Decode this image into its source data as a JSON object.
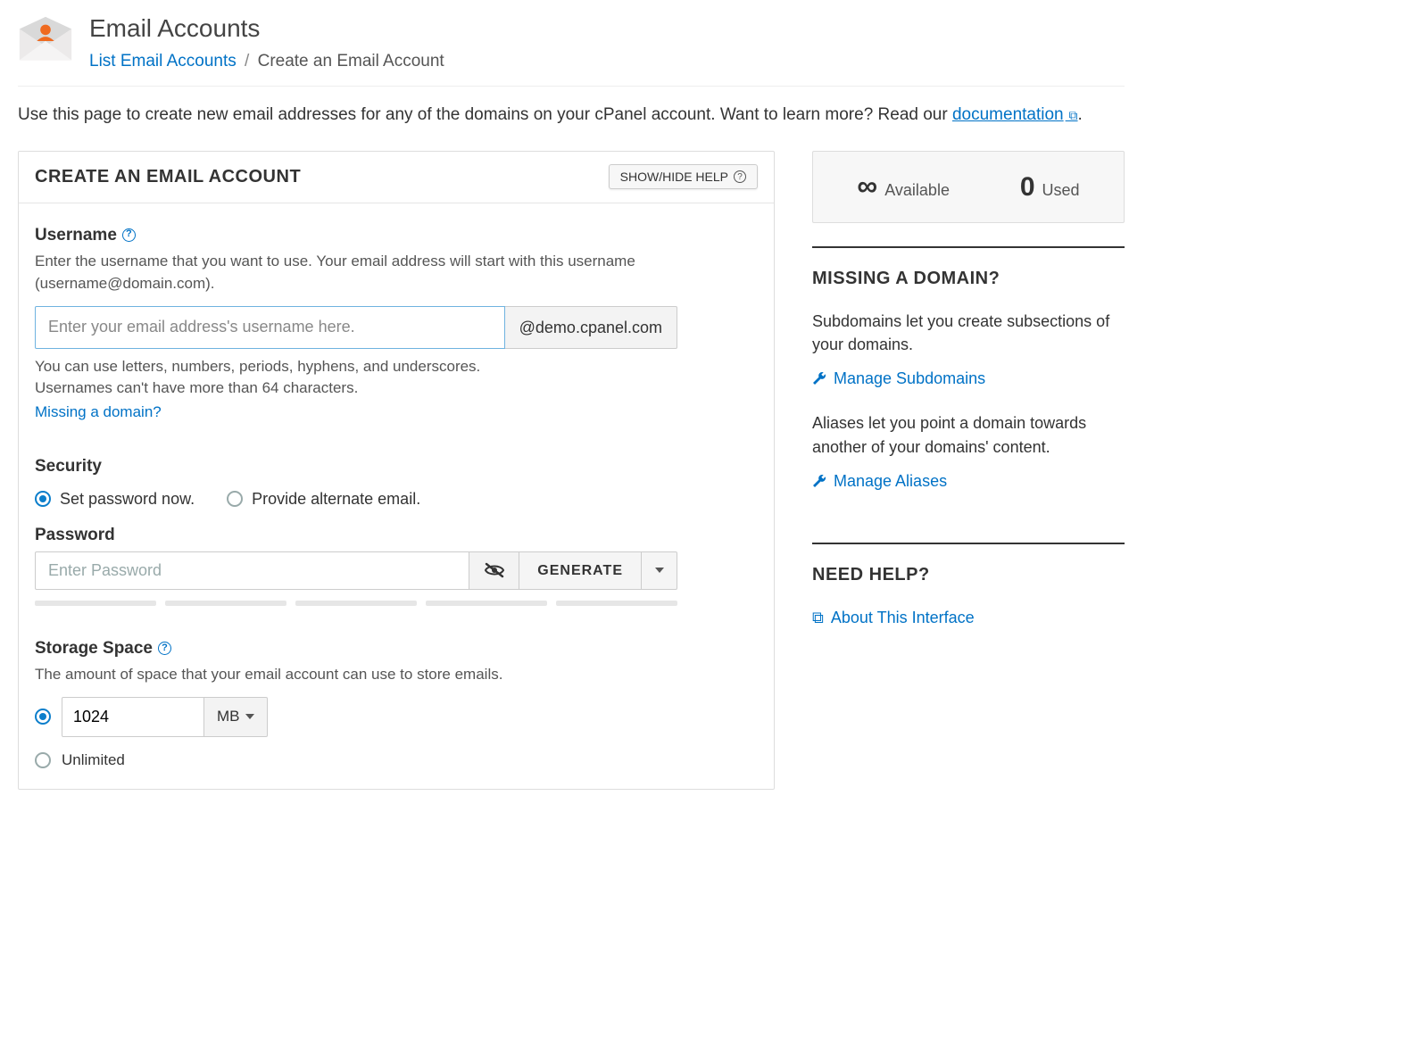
{
  "header": {
    "title": "Email Accounts",
    "breadcrumb_link": "List Email Accounts",
    "breadcrumb_current": "Create an Email Account"
  },
  "intro": {
    "text_before": "Use this page to create new email addresses for any of the domains on your cPanel account. Want to learn more? Read our ",
    "link_text": "documentation",
    "text_after": "."
  },
  "panel": {
    "title": "CREATE AN EMAIL ACCOUNT",
    "help_toggle": "SHOW/HIDE HELP"
  },
  "username": {
    "label": "Username",
    "help": "Enter the username that you want to use. Your email address will start with this username (username@domain.com).",
    "placeholder": "Enter your email address's username here.",
    "domain_suffix": "@demo.cpanel.com",
    "note": "You can use letters, numbers, periods, hyphens, and underscores. Usernames can't have more than 64 characters.",
    "missing_link": "Missing a domain?"
  },
  "security": {
    "label": "Security",
    "opt_set_now": "Set password now.",
    "opt_alt_email": "Provide alternate email.",
    "password_label": "Password",
    "password_placeholder": "Enter Password",
    "generate": "GENERATE"
  },
  "storage": {
    "label": "Storage Space",
    "help": "The amount of space that your email account can use to store emails.",
    "value": "1024",
    "unit": "MB",
    "unlimited": "Unlimited"
  },
  "sidebar": {
    "stats": {
      "available_symbol": "∞",
      "available_label": "Available",
      "used_value": "0",
      "used_label": "Used"
    },
    "missing": {
      "title": "MISSING A DOMAIN?",
      "subdomain_text": "Subdomains let you create subsections of your domains.",
      "subdomain_link": "Manage Subdomains",
      "alias_text": "Aliases let you point a domain towards another of your domains' content.",
      "alias_link": "Manage Aliases"
    },
    "help": {
      "title": "NEED HELP?",
      "about_link": "About This Interface"
    }
  }
}
